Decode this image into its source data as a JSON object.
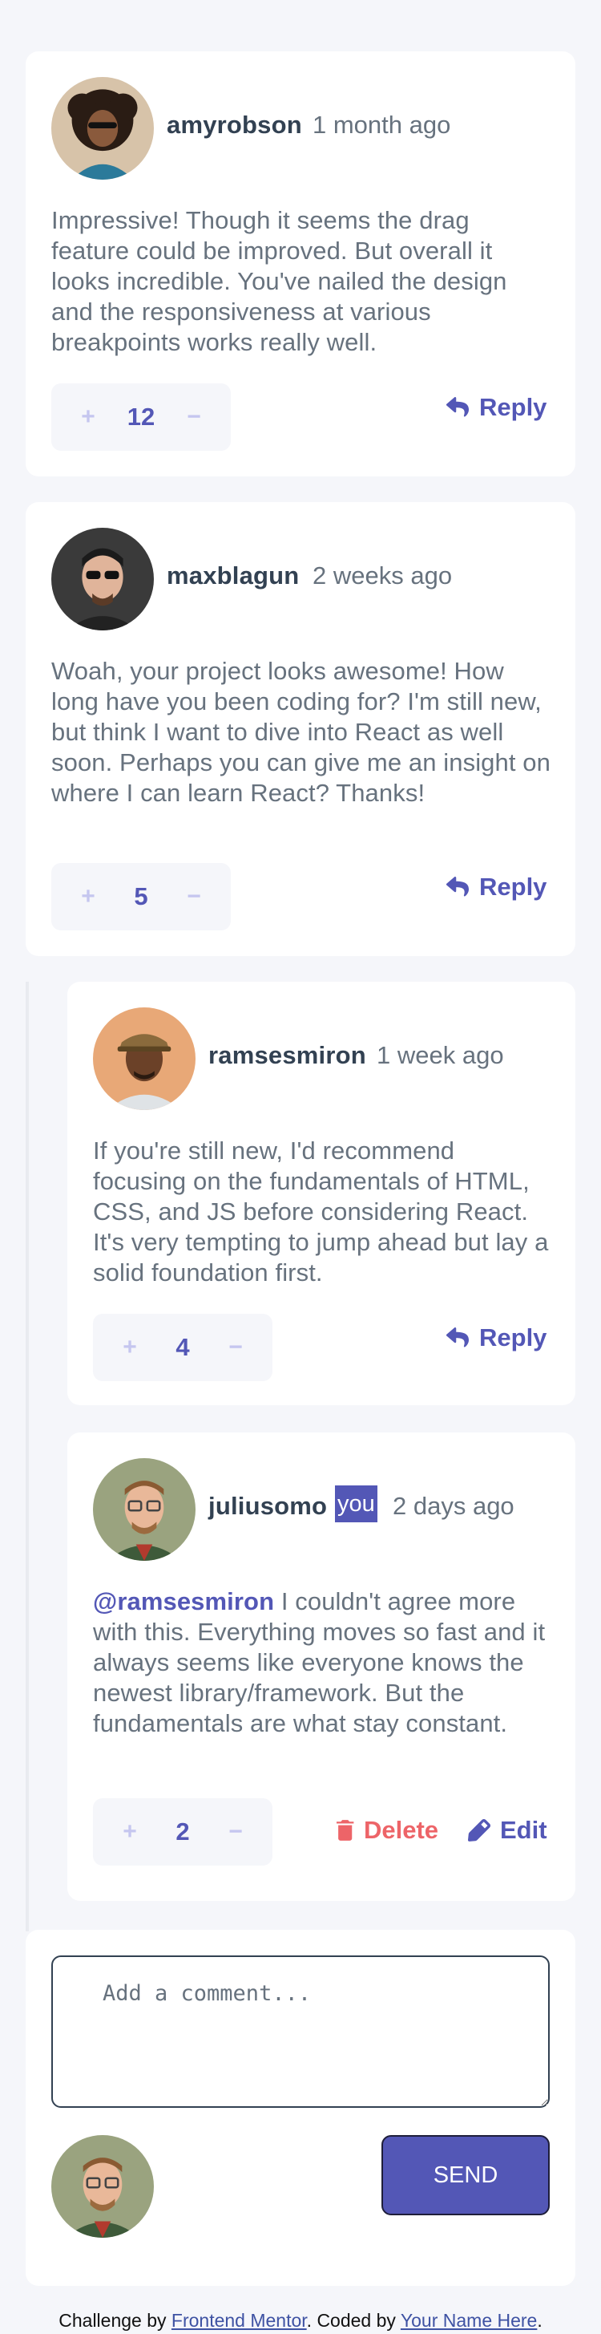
{
  "comments": [
    {
      "username": "amyrobson",
      "created_at": "1 month ago",
      "content": "Impressive! Though it seems the drag feature could be improved. But overall it looks incredible. You've nailed the design and the responsiveness at various breakpoints works really well.",
      "score": "12",
      "action": "Reply"
    },
    {
      "username": "maxblagun",
      "created_at": "2 weeks ago",
      "content": "Woah, your project looks awesome! How long have you been coding for? I'm still new, but think I want to dive into React as well soon. Perhaps you can give me an insight on where I can learn React? Thanks!",
      "score": "5",
      "action": "Reply"
    }
  ],
  "replies": [
    {
      "username": "ramsesmiron",
      "created_at": "1 week ago",
      "content": "If you're still new, I'd recommend focusing on the fundamentals of HTML, CSS, and JS before considering React. It's very tempting to jump ahead but lay a solid foundation first.",
      "score": "4",
      "action": "Reply"
    },
    {
      "username": "juliusomo",
      "you_badge": "you",
      "created_at": "2 days ago",
      "mention": "@ramsesmiron",
      "content": " I couldn't agree more with this. Everything moves so fast and it always seems like everyone knows the newest library/framework. But the fundamentals are what stay constant.",
      "score": "2",
      "delete_label": "Delete",
      "edit_label": "Edit"
    }
  ],
  "vote": {
    "plus": "+",
    "minus": "−"
  },
  "new_comment": {
    "placeholder": "Add a comment...",
    "send_label": "SEND"
  },
  "footer": {
    "prefix": "Challenge by ",
    "link1": "Frontend Mentor",
    "middle": ". Coded by ",
    "link2": "Your Name Here",
    "suffix": "."
  },
  "colors": {
    "primary": "#5357b6",
    "soft_red": "#ed6468",
    "light_grayish_blue": "#c5c6ef",
    "dark_blue": "#324152",
    "grayish_blue": "#67727e",
    "background": "#f5f6fa"
  }
}
